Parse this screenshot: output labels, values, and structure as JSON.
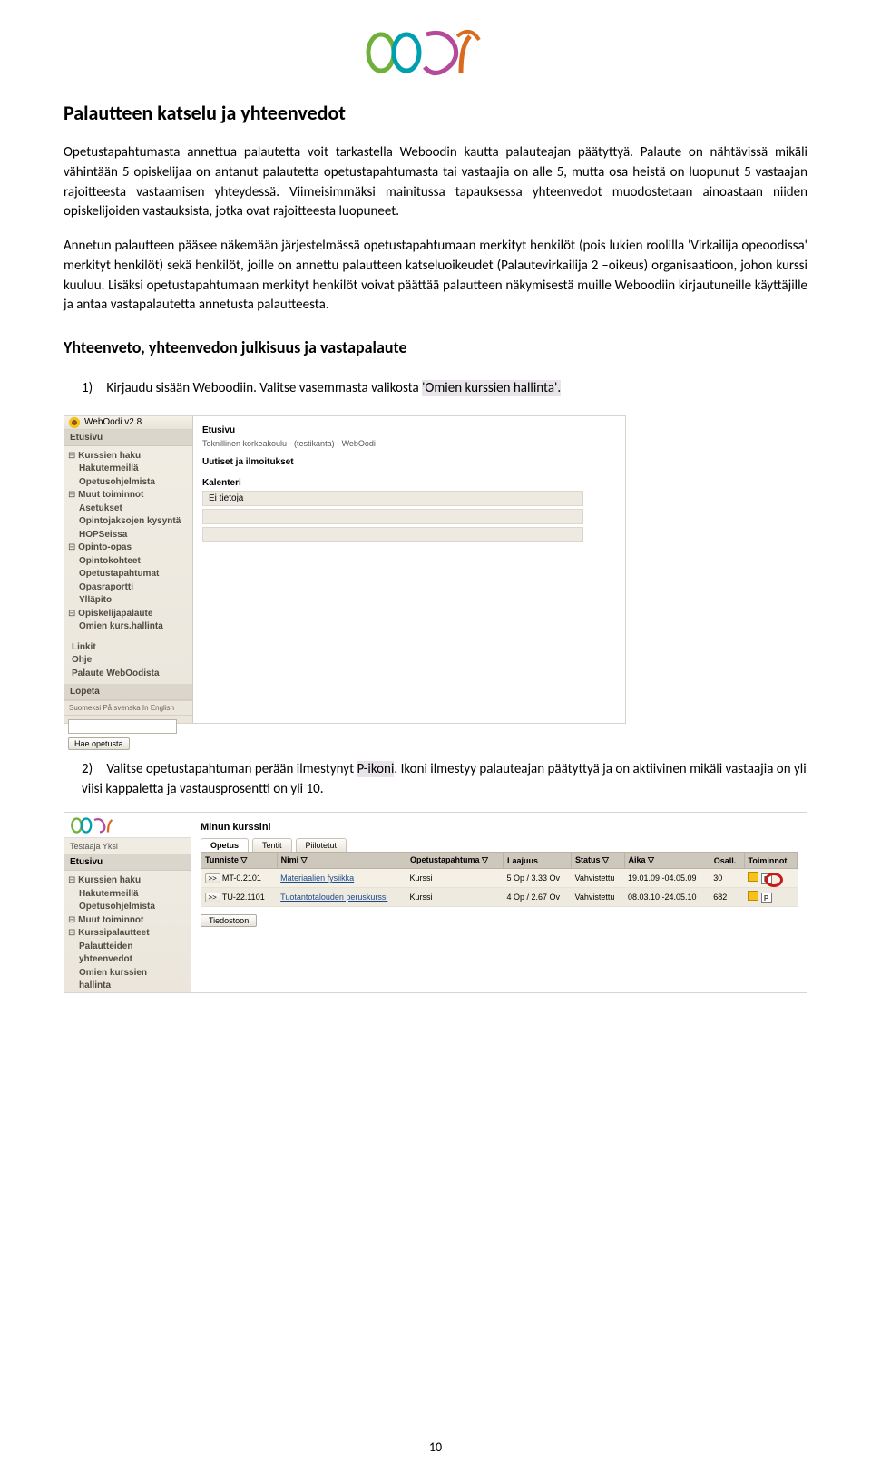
{
  "heading": "Palautteen katselu ja yhteenvedot",
  "para1": "Opetustapahtumasta annettua palautetta voit tarkastella Weboodin kautta palauteajan päätyttyä. Palaute on nähtävissä mikäli vähintään 5 opiskelijaa on antanut palautetta opetustapahtumasta tai vastaajia on alle 5, mutta osa heistä on luopunut 5 vastaajan rajoitteesta vastaamisen yhteydessä. Viimeisimmäksi mainitussa tapauksessa yhteenvedot muodostetaan ainoastaan niiden opiskelijoiden vastauksista, jotka ovat rajoitteesta luopuneet.",
  "para2": "Annetun palautteen pääsee näkemään järjestelmässä opetustapahtumaan merkityt henkilöt (pois lukien roolilla 'Virkailija opeoodissa' merkityt henkilöt) sekä henkilöt, joille on annettu palautteen katseluoikeudet (Palautevirkailija 2 –oikeus) organisaatioon, johon kurssi kuuluu. Lisäksi opetustapahtumaan merkityt henkilöt voivat päättää palautteen näkymisestä muille Weboodiin kirjautuneille käyttäjille ja antaa vastapalautetta annetusta palautteesta.",
  "subheading": "Yhteenveto, yhteenvedon julkisuus ja vastapalaute",
  "step1_num": "1)",
  "step1_pre": "Kirjaudu sisään Weboodiin. Valitse vasemmasta valikosta ",
  "step1_hl": "'Omien kurssien hallinta'.",
  "step2_num": "2)",
  "step2_pre": "Valitse opetustapahtuman perään ilmestynyt ",
  "step2_hl": "P-ikoni",
  "step2_post": ". Ikoni ilmestyy palauteajan päätyttyä ja on aktiivinen mikäli vastaajia on yli viisi kappaletta ja vastausprosentti on yli 10.",
  "page_number": "10",
  "shot1": {
    "version": "WebOodi v2.8",
    "etusivu_header": "Etusivu",
    "breadcrumb": "Etusivu",
    "org": "Teknillinen korkeakoulu - (testikanta) - WebOodi",
    "uutiset_title": "Uutiset ja ilmoitukset",
    "kalenteri_title": "Kalenteri",
    "kalenteri_row": "Ei tietoja",
    "nav": {
      "kurssien_haku": "Kurssien haku",
      "hakutermeilla": "Hakutermeillä",
      "opetusohjelmista": "Opetusohjelmista",
      "muut_toiminnot": "Muut toiminnot",
      "asetukset": "Asetukset",
      "opintojaksojen": "Opintojaksojen kysyntä",
      "hopseissa": "HOPSeissa",
      "opinto_opas": "Opinto-opas",
      "opintokohteet": "Opintokohteet",
      "opetustapahtumat": "Opetustapahtumat",
      "opasraportti": "Opasraportti",
      "yllapito": "Ylläpito",
      "opiskelijapalaute": "Opiskelijapalaute",
      "omien_kurs": "Omien kurs.hallinta",
      "linkit": "Linkit",
      "ohje": "Ohje",
      "palaute": "Palaute WebOodista",
      "lopeta": "Lopeta"
    },
    "lang": "Suomeksi  På svenska  In English",
    "search_btn": "Hae opetusta"
  },
  "shot2": {
    "user": "Testaaja Yksi",
    "etusivu_header": "Etusivu",
    "title": "Minun kurssini",
    "tabs": {
      "opetus": "Opetus",
      "tentit": "Tentit",
      "piilotetut": "Piilotetut"
    },
    "nav": {
      "kurssien_haku": "Kurssien haku",
      "hakutermeilla": "Hakutermeillä",
      "opetusohjelmista": "Opetusohjelmista",
      "muut_toiminnot": "Muut toiminnot",
      "kurssipalautteet": "Kurssipalautteet",
      "palautteiden": "Palautteiden",
      "yhteenvedot": "yhteenvedot",
      "omien_kurssien": "Omien kurssien",
      "hallinta": "hallinta"
    },
    "cols": {
      "tunniste": "Tunniste ▽",
      "nimi": "Nimi ▽",
      "tapahtuma": "Opetustapahtuma ▽",
      "laajuus": "Laajuus",
      "status": "Status ▽",
      "aika": "Aika ▽",
      "osall": "Osall.",
      "toiminnot": "Toiminnot"
    },
    "rows": [
      {
        "id": ">>",
        "tun": "MT-0.2101",
        "nimi": "Materiaalien fysiikka",
        "tap": "Kurssi",
        "laaj": "5 Op / 3.33 Ov",
        "stat": "Vahvistettu",
        "aika": "19.01.09 -04.05.09",
        "os": "30"
      },
      {
        "id": ">>",
        "tun": "TU-22.1101",
        "nimi": "Tuotantotalouden peruskurssi",
        "tap": "Kurssi",
        "laaj": "4 Op / 2.67 Ov",
        "stat": "Vahvistettu",
        "aika": "08.03.10 -24.05.10",
        "os": "682"
      }
    ],
    "filebtn": "Tiedostoon"
  }
}
